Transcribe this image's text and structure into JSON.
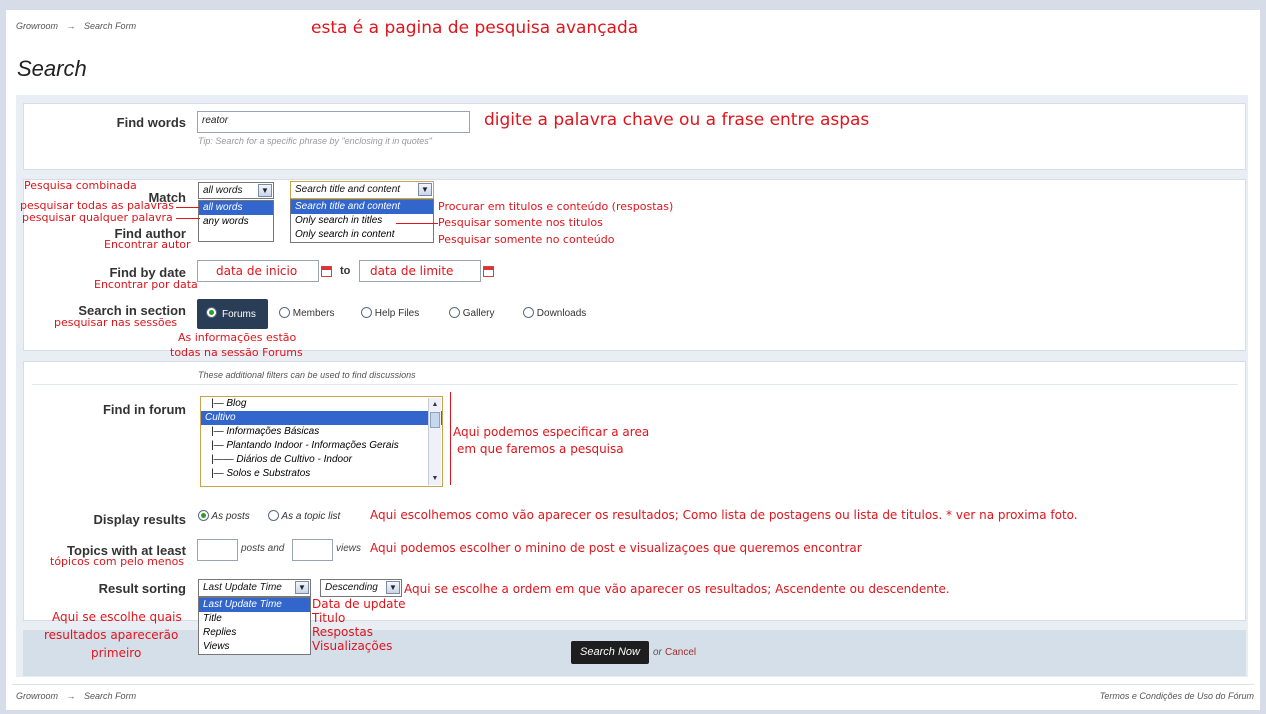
{
  "breadcrumb": {
    "home": "Growroom",
    "sep": "→",
    "current": "Search Form"
  },
  "page_title": "Search",
  "find_words": {
    "label": "Find words",
    "value": "reator",
    "tip": "Tip: Search for a specific phrase by \"enclosing it in quotes\""
  },
  "match": {
    "label": "Match",
    "words_selected": "all words",
    "words_options": [
      "all words",
      "any words"
    ],
    "scope_selected": "Search title and content",
    "scope_options": [
      "Search title and content",
      "Only search in titles",
      "Only search in content"
    ]
  },
  "find_author": {
    "label": "Find author"
  },
  "find_by_date": {
    "label": "Find by date",
    "to": "to"
  },
  "search_in_section": {
    "label": "Search in section",
    "options": [
      "Forums",
      "Members",
      "Help Files",
      "Gallery",
      "Downloads"
    ]
  },
  "filters_note": "These additional filters can be used to find discussions",
  "find_in_forum": {
    "label": "Find in forum",
    "items": [
      "|— Blog",
      "Cultivo",
      "|— Informações Básicas",
      "|— Plantando Indoor - Informações Gerais",
      "|—— Diários de Cultivo - Indoor",
      "|— Solos e Substratos"
    ]
  },
  "display_results": {
    "label": "Display results",
    "options": [
      "As posts",
      "As a topic list"
    ]
  },
  "topics_at_least": {
    "label": "Topics with at least",
    "posts": "posts and",
    "views": "views"
  },
  "result_sorting": {
    "label": "Result sorting",
    "selected": "Last Update Time",
    "options": [
      "Last Update Time",
      "Title",
      "Replies",
      "Views"
    ],
    "order": "Descending"
  },
  "search_button": "Search Now",
  "or_text": "or",
  "cancel_link": "Cancel",
  "footer_link": "Termos e Condições de Uso do Fórum",
  "annotations": {
    "top": "esta é a pagina de pesquisa avançada",
    "find_words": "digite a palavra chave ou a frase entre aspas",
    "combined": "Pesquisa combinada",
    "all_words": "pesquisar todas as palavras",
    "any_word": "pesquisar qualquer palavra",
    "author": "Encontrar autor",
    "title_content": "Procurar em titulos e conteúdo (respostas)",
    "only_titles": "Pesquisar somente nos titulos",
    "only_content": "Pesquisar somente no conteúdo",
    "start_date": "data de inicio",
    "end_date": "data de limite",
    "by_date": "Encontrar por data",
    "sections": "pesquisar nas sessões",
    "info_1": "As informações estão",
    "info_2": "todas na sessão Forums",
    "forum_1": "Aqui podemos especificar a area",
    "forum_2": "em que faremos a pesquisa",
    "display": "Aqui escolhemos como vão aparecer os resultados; Como lista de postagens ou lista de titulos. * ver na proxima foto.",
    "topics_1": "tópicos com pelo menos",
    "topics_2": "Aqui podemos escolher o minino de post e visualizaçoes que queremos encontrar",
    "order": "Aqui se escolhe a ordem em que vão aparecer os resultados; Ascendente ou descendente.",
    "sort_update": "Data de update",
    "sort_title": "Titulo",
    "sort_replies": "Respostas",
    "sort_views": "Visualizações",
    "which_1": "Aqui se escolhe quais",
    "which_2": "resultados aparecerão",
    "which_3": "primeiro"
  }
}
